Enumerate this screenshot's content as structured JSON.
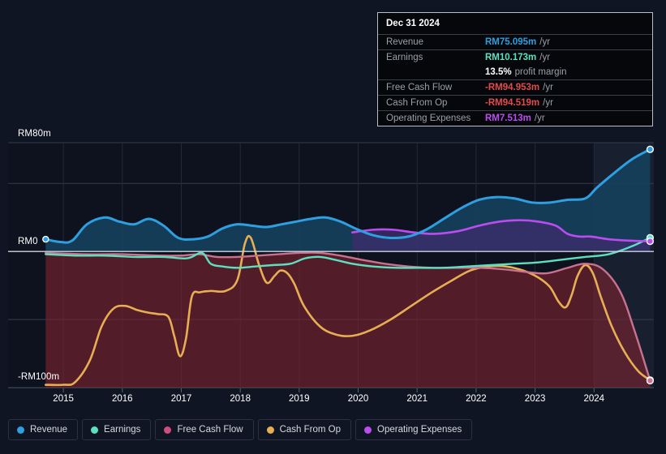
{
  "chart_data": {
    "type": "area",
    "title": "",
    "xlabel": "",
    "ylabel": "",
    "currency_prefix": "RM",
    "unit_suffix": "m",
    "ylim": [
      -100,
      80
    ],
    "grid": true,
    "y_ticks": [
      {
        "value": 80,
        "label": "RM80m"
      },
      {
        "value": 0,
        "label": "RM0"
      },
      {
        "value": -100,
        "label": "-RM100m"
      }
    ],
    "y_gridlines": [
      80,
      50,
      0,
      -50,
      -100
    ],
    "x_ticks": [
      "2015",
      "2016",
      "2017",
      "2018",
      "2019",
      "2020",
      "2021",
      "2022",
      "2023",
      "2024"
    ],
    "xlim": [
      2014.6,
      2025.0
    ],
    "forecast_band_start": "2024",
    "legend_position": "bottom",
    "series": [
      {
        "name": "Revenue",
        "color": "#2e9fe0",
        "fill": "#16405c",
        "points": [
          [
            2014.7,
            9
          ],
          [
            2014.95,
            7
          ],
          [
            2015.15,
            8
          ],
          [
            2015.4,
            20
          ],
          [
            2015.7,
            25
          ],
          [
            2015.95,
            22
          ],
          [
            2016.2,
            20
          ],
          [
            2016.45,
            24
          ],
          [
            2016.7,
            19
          ],
          [
            2016.95,
            10
          ],
          [
            2017.2,
            9
          ],
          [
            2017.45,
            11
          ],
          [
            2017.7,
            17
          ],
          [
            2017.95,
            20
          ],
          [
            2018.2,
            19
          ],
          [
            2018.45,
            18
          ],
          [
            2018.7,
            20
          ],
          [
            2018.95,
            22
          ],
          [
            2019.2,
            24
          ],
          [
            2019.45,
            25
          ],
          [
            2019.7,
            22
          ],
          [
            2019.95,
            17
          ],
          [
            2020.25,
            12
          ],
          [
            2020.55,
            10
          ],
          [
            2020.85,
            11
          ],
          [
            2021.15,
            16
          ],
          [
            2021.45,
            24
          ],
          [
            2021.75,
            32
          ],
          [
            2022.05,
            38
          ],
          [
            2022.35,
            40
          ],
          [
            2022.65,
            39
          ],
          [
            2022.95,
            36
          ],
          [
            2023.25,
            36
          ],
          [
            2023.55,
            38
          ],
          [
            2023.85,
            39
          ],
          [
            2024.05,
            47
          ],
          [
            2024.35,
            58
          ],
          [
            2024.65,
            68
          ],
          [
            2024.95,
            75.095
          ]
        ],
        "end_value": 75.095,
        "end_label": "RM75.095m /yr"
      },
      {
        "name": "Earnings",
        "color": "#5de0c0",
        "fill": "none",
        "points": [
          [
            2014.7,
            -2
          ],
          [
            2015.2,
            -3
          ],
          [
            2015.7,
            -3
          ],
          [
            2016.2,
            -4
          ],
          [
            2016.7,
            -4
          ],
          [
            2017.1,
            -5
          ],
          [
            2017.35,
            -1
          ],
          [
            2017.5,
            -9
          ],
          [
            2017.7,
            -11
          ],
          [
            2017.95,
            -12
          ],
          [
            2018.25,
            -11
          ],
          [
            2018.55,
            -10
          ],
          [
            2018.85,
            -9
          ],
          [
            2019.1,
            -5
          ],
          [
            2019.35,
            -4
          ],
          [
            2019.6,
            -6
          ],
          [
            2019.9,
            -9
          ],
          [
            2020.25,
            -11
          ],
          [
            2020.65,
            -12
          ],
          [
            2021.05,
            -12
          ],
          [
            2021.45,
            -12
          ],
          [
            2021.85,
            -11
          ],
          [
            2022.25,
            -10
          ],
          [
            2022.65,
            -9
          ],
          [
            2023.05,
            -8
          ],
          [
            2023.45,
            -6
          ],
          [
            2023.85,
            -4
          ],
          [
            2024.25,
            -2
          ],
          [
            2024.65,
            4
          ],
          [
            2024.95,
            10.173
          ]
        ],
        "end_value": 10.173,
        "end_label": "RM10.173m /yr"
      },
      {
        "name": "Free Cash Flow",
        "color": "#c8728f",
        "fill": "#7e2430",
        "points": [
          [
            2014.7,
            -1
          ],
          [
            2015.4,
            -2
          ],
          [
            2016.0,
            -2
          ],
          [
            2016.6,
            -3
          ],
          [
            2017.0,
            -3
          ],
          [
            2017.3,
            -2
          ],
          [
            2017.6,
            -4
          ],
          [
            2017.95,
            -4
          ],
          [
            2018.3,
            -3
          ],
          [
            2018.65,
            -2
          ],
          [
            2019.0,
            -1
          ],
          [
            2019.35,
            -1
          ],
          [
            2019.7,
            -3
          ],
          [
            2020.05,
            -6
          ],
          [
            2020.45,
            -9
          ],
          [
            2020.85,
            -11
          ],
          [
            2021.25,
            -12
          ],
          [
            2021.65,
            -12
          ],
          [
            2022.05,
            -12
          ],
          [
            2022.45,
            -13
          ],
          [
            2022.85,
            -15
          ],
          [
            2023.2,
            -16
          ],
          [
            2023.55,
            -12
          ],
          [
            2023.85,
            -9
          ],
          [
            2024.15,
            -13
          ],
          [
            2024.45,
            -30
          ],
          [
            2024.7,
            -60
          ],
          [
            2024.95,
            -94.953
          ]
        ],
        "end_value": -94.953,
        "end_label": "-RM94.953m /yr"
      },
      {
        "name": "Cash From Op",
        "color": "#e8ae54",
        "fill": "none",
        "points": [
          [
            2014.7,
            -98
          ],
          [
            2015.0,
            -98
          ],
          [
            2015.2,
            -96
          ],
          [
            2015.45,
            -80
          ],
          [
            2015.65,
            -55
          ],
          [
            2015.85,
            -42
          ],
          [
            2016.05,
            -40
          ],
          [
            2016.25,
            -43
          ],
          [
            2016.45,
            -45
          ],
          [
            2016.6,
            -46
          ],
          [
            2016.78,
            -48
          ],
          [
            2016.88,
            -62
          ],
          [
            2016.98,
            -77
          ],
          [
            2017.08,
            -64
          ],
          [
            2017.18,
            -33
          ],
          [
            2017.32,
            -30
          ],
          [
            2017.5,
            -29
          ],
          [
            2017.75,
            -29
          ],
          [
            2017.95,
            -21
          ],
          [
            2018.08,
            6
          ],
          [
            2018.18,
            10
          ],
          [
            2018.32,
            -10
          ],
          [
            2018.45,
            -23
          ],
          [
            2018.58,
            -18
          ],
          [
            2018.68,
            -14
          ],
          [
            2018.8,
            -16
          ],
          [
            2018.92,
            -24
          ],
          [
            2019.08,
            -40
          ],
          [
            2019.35,
            -55
          ],
          [
            2019.62,
            -61
          ],
          [
            2019.9,
            -62
          ],
          [
            2020.2,
            -58
          ],
          [
            2020.55,
            -50
          ],
          [
            2020.9,
            -40
          ],
          [
            2021.25,
            -30
          ],
          [
            2021.6,
            -21
          ],
          [
            2021.9,
            -14
          ],
          [
            2022.2,
            -11
          ],
          [
            2022.5,
            -11
          ],
          [
            2022.8,
            -14
          ],
          [
            2023.05,
            -19
          ],
          [
            2023.25,
            -26
          ],
          [
            2023.4,
            -37
          ],
          [
            2023.52,
            -41
          ],
          [
            2023.62,
            -32
          ],
          [
            2023.72,
            -18
          ],
          [
            2023.85,
            -10
          ],
          [
            2023.98,
            -16
          ],
          [
            2024.12,
            -34
          ],
          [
            2024.3,
            -55
          ],
          [
            2024.52,
            -74
          ],
          [
            2024.75,
            -88
          ],
          [
            2024.95,
            -94.519
          ]
        ],
        "end_value": -94.519,
        "end_label": "-RM94.519m /yr"
      },
      {
        "name": "Operating Expenses",
        "color": "#bb4df0",
        "fill": "#3b2d6b",
        "points": [
          [
            2019.9,
            14
          ],
          [
            2020.25,
            16
          ],
          [
            2020.6,
            16
          ],
          [
            2020.95,
            14
          ],
          [
            2021.3,
            13
          ],
          [
            2021.7,
            15
          ],
          [
            2022.05,
            19
          ],
          [
            2022.4,
            22
          ],
          [
            2022.75,
            23
          ],
          [
            2023.05,
            22
          ],
          [
            2023.35,
            19
          ],
          [
            2023.55,
            13
          ],
          [
            2023.75,
            11
          ],
          [
            2023.95,
            11
          ],
          [
            2024.25,
            9
          ],
          [
            2024.6,
            8
          ],
          [
            2024.95,
            7.513
          ]
        ],
        "end_value": 7.513,
        "end_label": "RM7.513m /yr"
      }
    ]
  },
  "tooltip": {
    "title": "Dec 31 2024",
    "rows": [
      {
        "label": "Revenue",
        "value": "RM75.095m",
        "unit": "/yr",
        "color": "#2e9fe0"
      },
      {
        "label": "Earnings",
        "value": "RM10.173m",
        "unit": "/yr",
        "color": "#5de0c0"
      },
      {
        "label": "",
        "value": "13.5%",
        "unit": "profit margin",
        "color": "#ffffff"
      },
      {
        "label": "Free Cash Flow",
        "value": "-RM94.953m",
        "unit": "/yr",
        "color": "#e04b4b"
      },
      {
        "label": "Cash From Op",
        "value": "-RM94.519m",
        "unit": "/yr",
        "color": "#e04b4b"
      },
      {
        "label": "Operating Expenses",
        "value": "RM7.513m",
        "unit": "/yr",
        "color": "#bb4df0"
      }
    ]
  },
  "legend": {
    "items": [
      {
        "label": "Revenue",
        "color": "#2e9fe0"
      },
      {
        "label": "Earnings",
        "color": "#5de0c0"
      },
      {
        "label": "Free Cash Flow",
        "color": "#cf4d7e"
      },
      {
        "label": "Cash From Op",
        "color": "#e8ae54"
      },
      {
        "label": "Operating Expenses",
        "color": "#bb4df0"
      }
    ]
  }
}
